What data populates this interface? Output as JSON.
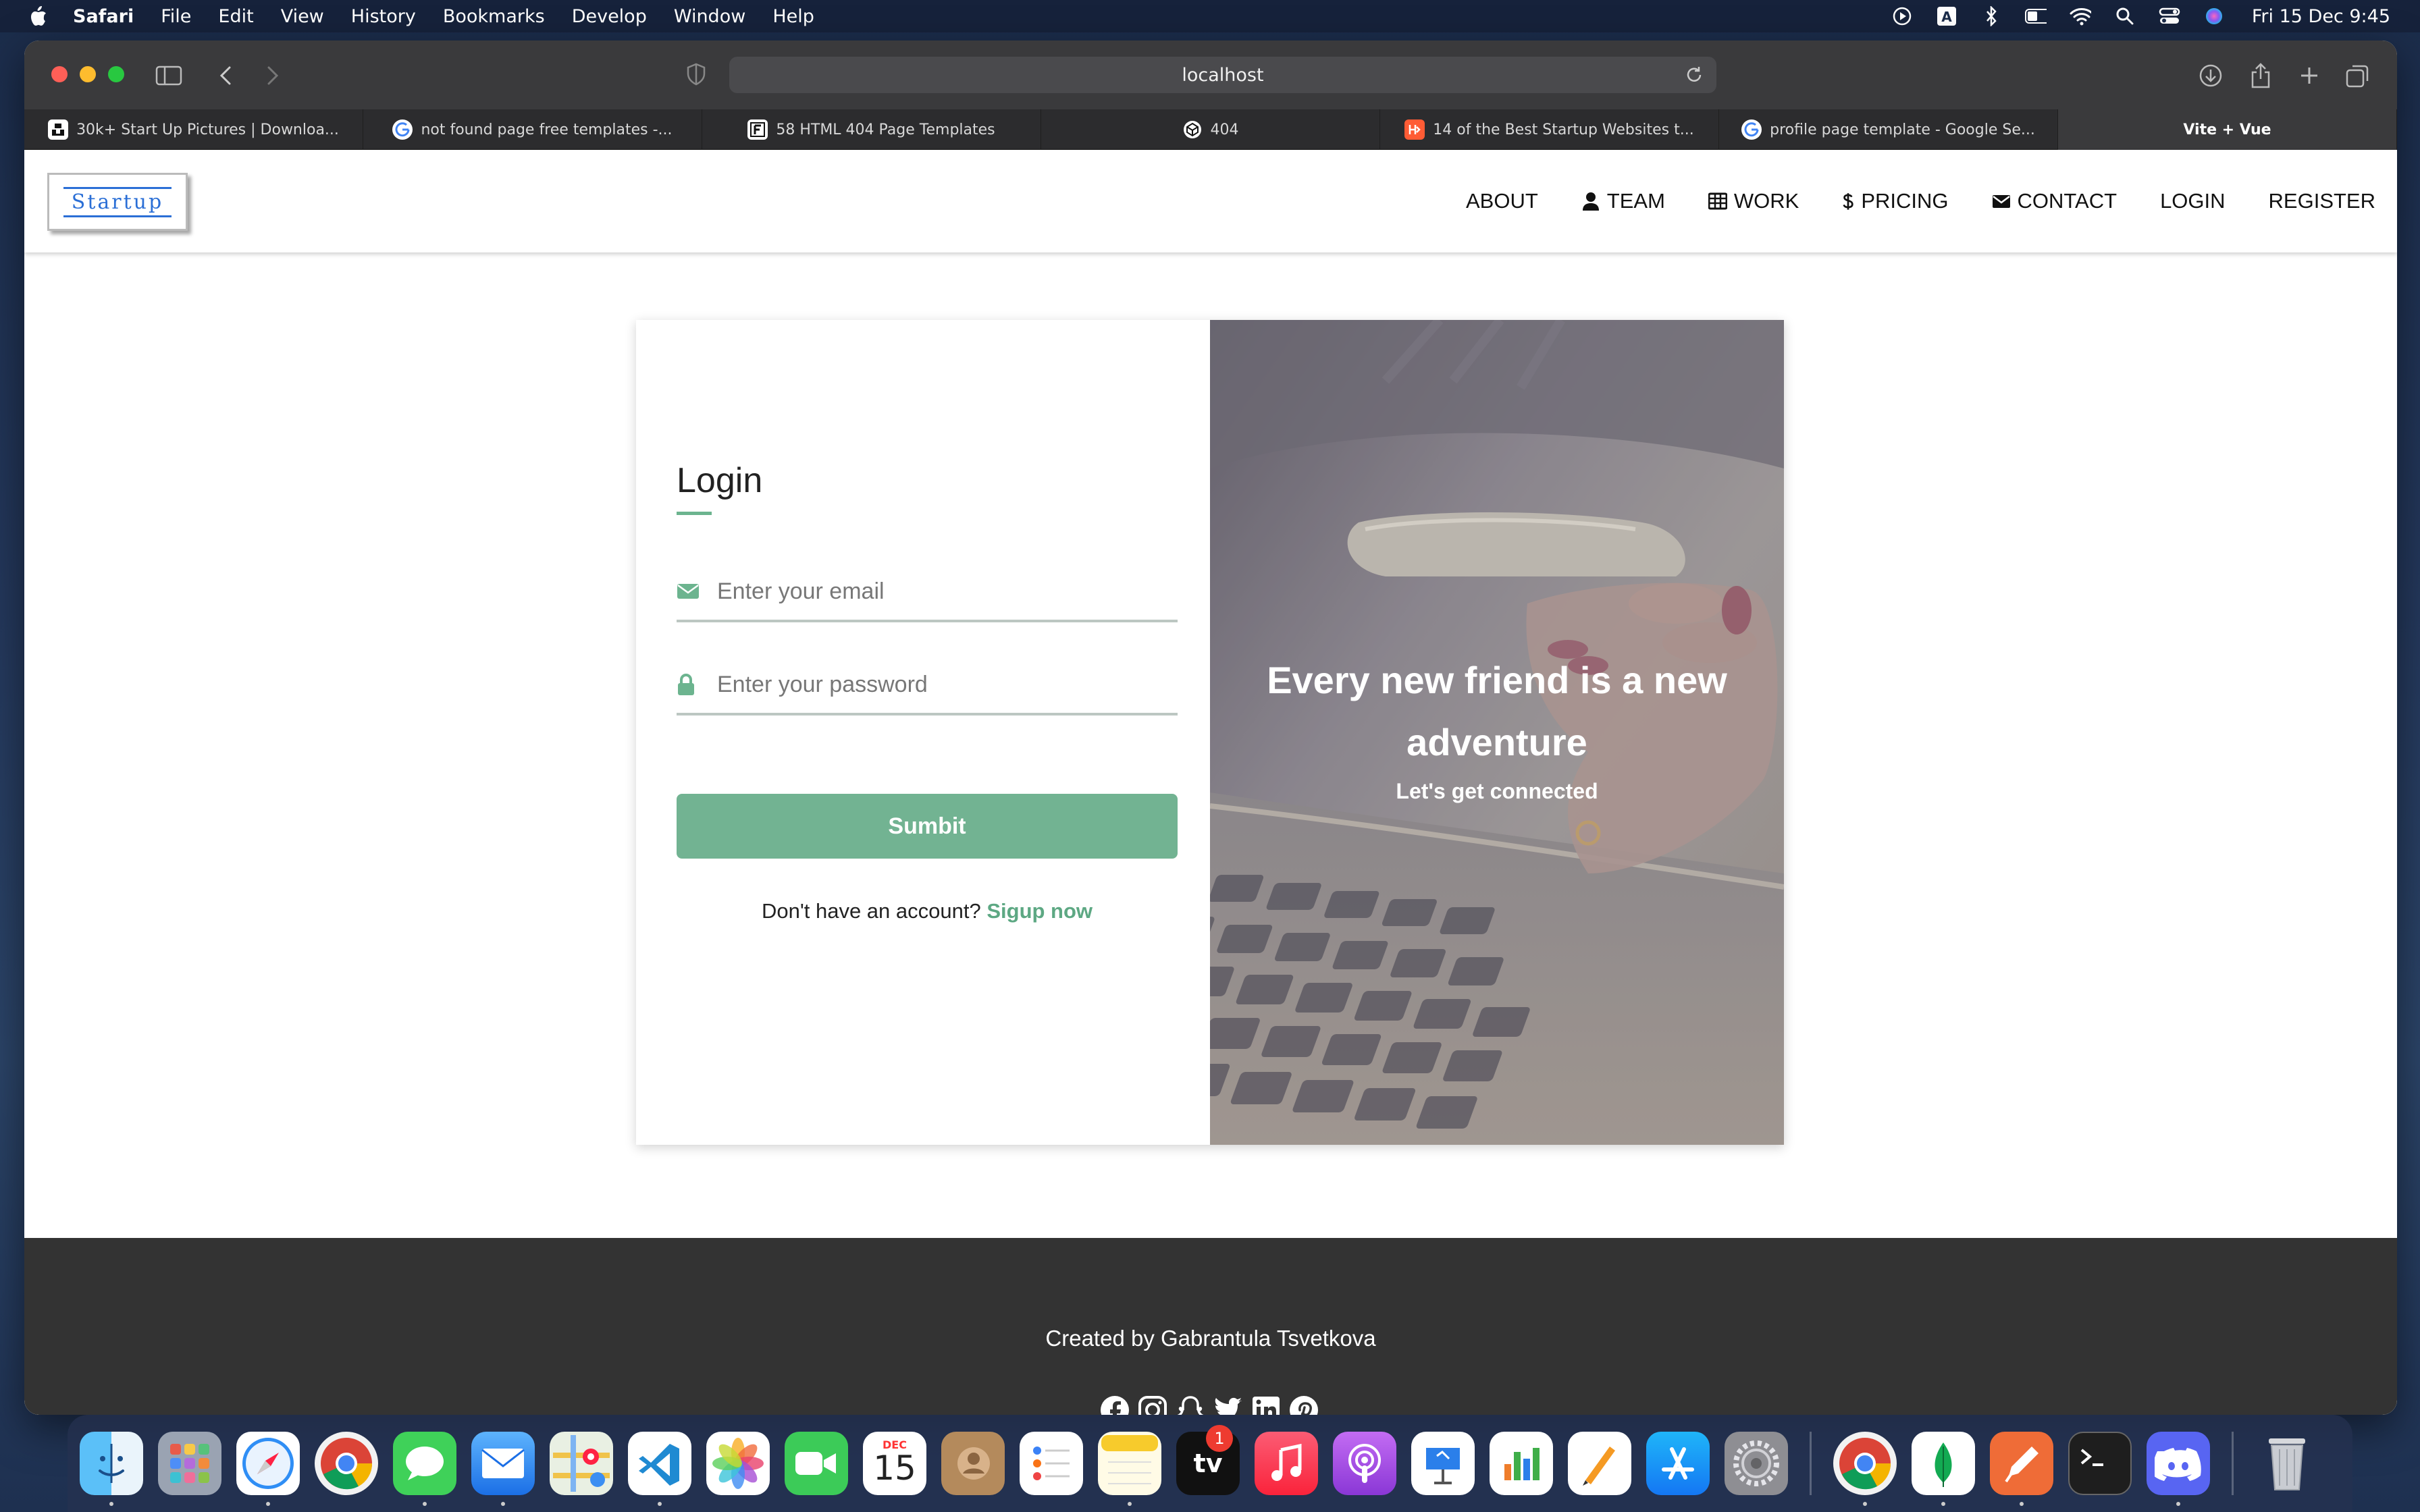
{
  "menubar": {
    "app_name": "Safari",
    "items": [
      "File",
      "Edit",
      "View",
      "History",
      "Bookmarks",
      "Develop",
      "Window",
      "Help"
    ],
    "keyboard_indicator": "A",
    "clock": "Fri 15 Dec  9:45"
  },
  "browser": {
    "url": "localhost",
    "tabs": [
      {
        "label": "30k+ Start Up Pictures | Downloa...",
        "icon": "unsplash-icon"
      },
      {
        "label": "not found page  free templates -...",
        "icon": "google-icon"
      },
      {
        "label": "58 HTML 404 Page Templates",
        "icon": "freefrontend-icon"
      },
      {
        "label": "404",
        "icon": "codepen-icon"
      },
      {
        "label": "14 of the Best Startup Websites t...",
        "icon": "hubspot-icon"
      },
      {
        "label": "profile page template - Google Se...",
        "icon": "google-icon"
      },
      {
        "label": "Vite + Vue",
        "icon": "",
        "active": true
      }
    ]
  },
  "site": {
    "logo_text": "Startup",
    "nav": {
      "about": "ABOUT",
      "team": "TEAM",
      "work": "WORK",
      "pricing": "PRICING",
      "contact": "CONTACT",
      "login": "LOGIN",
      "register": "REGISTER"
    },
    "login": {
      "title": "Login",
      "email_placeholder": "Enter your email",
      "password_placeholder": "Enter your password",
      "submit_label": "Sumbit",
      "signup_prompt": "Don't have an account?",
      "signup_link": "Sigup now"
    },
    "hero": {
      "title": "Every new friend is a new adventure",
      "subtitle": "Let's get connected"
    },
    "footer": {
      "credit": "Created by Gabrantula Tsvetkova",
      "social": [
        "facebook-icon",
        "instagram-icon",
        "snapchat-icon",
        "twitter-icon",
        "linkedin-icon",
        "pinterest-icon"
      ]
    }
  },
  "dock": {
    "calendar_month": "DEC",
    "calendar_day": "15",
    "tv_badge": "1",
    "apps": [
      "finder",
      "launchpad",
      "safari",
      "chrome",
      "messages",
      "mail",
      "maps",
      "vscode",
      "photos",
      "facetime",
      "calendar",
      "contacts",
      "reminders",
      "notes",
      "tv",
      "music",
      "podcasts",
      "keynote",
      "numbers",
      "pages",
      "app-store",
      "system-settings",
      "chrome",
      "mongodb-compass",
      "postman",
      "terminal",
      "discord",
      "trash"
    ]
  },
  "colors": {
    "accent_green": "#72b392",
    "link_green": "#5da883",
    "footer_bg": "#333333",
    "logo_blue": "#2b6fd6"
  }
}
